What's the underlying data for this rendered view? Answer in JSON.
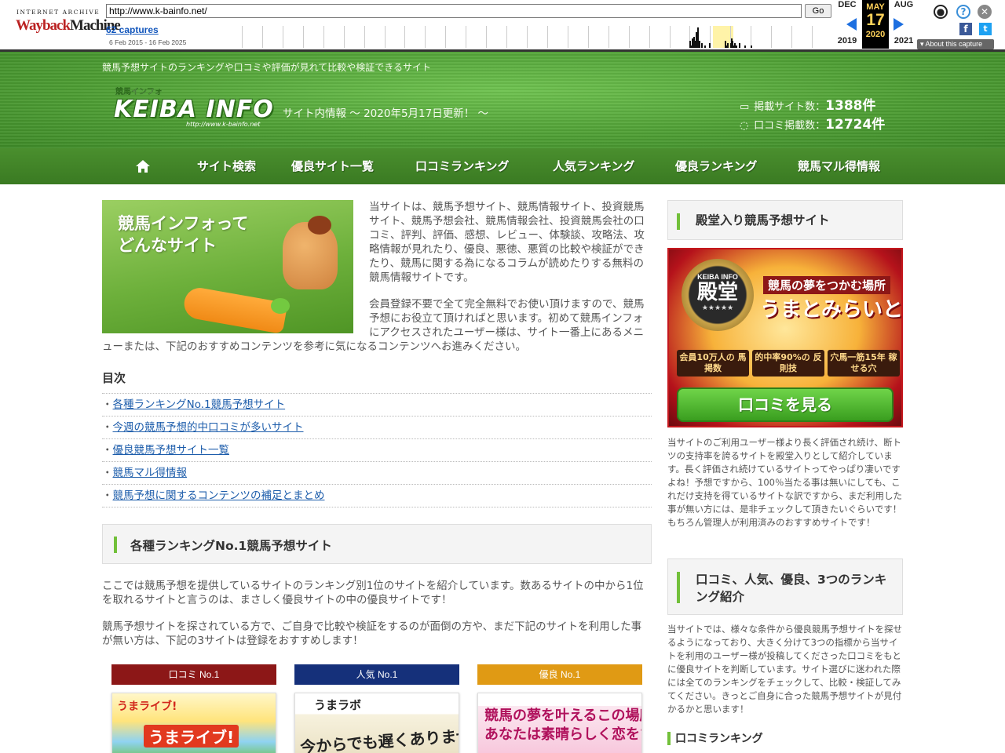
{
  "wayback": {
    "logo_top": "INTERNET ARCHIVE",
    "logo_wayback": "Wayback",
    "logo_machine": "Machine",
    "url": "http://www.k-bainfo.net/",
    "go_label": "Go",
    "captures": "62 captures",
    "range": "6 Feb 2015 - 16 Feb 2025",
    "prev_month": "DEC",
    "cur_month": "MAY",
    "next_month": "AUG",
    "cur_day": "17",
    "prev_year": "2019",
    "cur_year": "2020",
    "next_year": "2021",
    "about": "About this capture",
    "sparkline": [
      0,
      0,
      0,
      0,
      0,
      0,
      0,
      0,
      0,
      0,
      0,
      0,
      0,
      0,
      0,
      0,
      0,
      0,
      0,
      0,
      0,
      0,
      0,
      0,
      0,
      0,
      0,
      0,
      0,
      0,
      0,
      0,
      0,
      0,
      0,
      0,
      0,
      0,
      0,
      0,
      0,
      0,
      0,
      0,
      0,
      0,
      0,
      0,
      0,
      0,
      0,
      0,
      0,
      0,
      0,
      0,
      0,
      0,
      0,
      0,
      0,
      0,
      0,
      0,
      0,
      0,
      0,
      0,
      0,
      0,
      0,
      0,
      0,
      0,
      0,
      0,
      0,
      0,
      0,
      0,
      0,
      0,
      0,
      0,
      0,
      0,
      0,
      0,
      0,
      0,
      0,
      0,
      0,
      0,
      0,
      0,
      0,
      0,
      0,
      0,
      0,
      0,
      0,
      0,
      0,
      0,
      0,
      0,
      0,
      0,
      0,
      0,
      0,
      0,
      0,
      0,
      0,
      0,
      0,
      0,
      0,
      0,
      0,
      0,
      0,
      0,
      0,
      0,
      0,
      0,
      0,
      0,
      0,
      0,
      0,
      0,
      0,
      0,
      0,
      0,
      0,
      0,
      0,
      0,
      0,
      0,
      0,
      0,
      0,
      0,
      0,
      0,
      0,
      0,
      0,
      0,
      0,
      0,
      0,
      0,
      0,
      0,
      0,
      0,
      0,
      0,
      0,
      0,
      0,
      0,
      0,
      0,
      0,
      0,
      0,
      0,
      0,
      0,
      0,
      0,
      0,
      0,
      0,
      0,
      0,
      0,
      0,
      0,
      0,
      0,
      0,
      0,
      0,
      0,
      0,
      0,
      0,
      0,
      0,
      0,
      0,
      0,
      0,
      0,
      0,
      0,
      0,
      0,
      0,
      0,
      0,
      0,
      0,
      0,
      0,
      0,
      0,
      0,
      0,
      0,
      0,
      0,
      0,
      0,
      0,
      0,
      0,
      0,
      0,
      0,
      0,
      0,
      0,
      0,
      0,
      0,
      0,
      0,
      0,
      0,
      0,
      0,
      0,
      0,
      0,
      0,
      0,
      0,
      0,
      0,
      0,
      0,
      0,
      0,
      0,
      0,
      0,
      0,
      0,
      0,
      0,
      0,
      0,
      0,
      0,
      0,
      0,
      0,
      0,
      0,
      0,
      0,
      0,
      0,
      0,
      0,
      0,
      0,
      0,
      0,
      0,
      0,
      0,
      0,
      0,
      0,
      0,
      0,
      0,
      0,
      0,
      0,
      0,
      0,
      0,
      0,
      0,
      0,
      0,
      0,
      0,
      0,
      0,
      0,
      0,
      0,
      0,
      0,
      0,
      0,
      0,
      0,
      0,
      0,
      0,
      0,
      0,
      0,
      0,
      0,
      0,
      0,
      0,
      0,
      0,
      0,
      0,
      0,
      0,
      0,
      0,
      0,
      0,
      0,
      0,
      0,
      0,
      0,
      0,
      0,
      0,
      0,
      0,
      0,
      0,
      0,
      0,
      0,
      0,
      0,
      0,
      0,
      0,
      0,
      0,
      0,
      0,
      0,
      0,
      0,
      0,
      0,
      0,
      0,
      0,
      0,
      0,
      0,
      0,
      0,
      0,
      0,
      0,
      0,
      0,
      0,
      0,
      0,
      0,
      0,
      0,
      0,
      0,
      0,
      0,
      0,
      0,
      0,
      0,
      0,
      0,
      0,
      0,
      0,
      0,
      0,
      0,
      0,
      0,
      0,
      0,
      0,
      0,
      0,
      0,
      0,
      0,
      0,
      0,
      0,
      0,
      0,
      0,
      0,
      0,
      0,
      0,
      0,
      0,
      0,
      0,
      0,
      0,
      0,
      0,
      0,
      0,
      0,
      0,
      0,
      0,
      0,
      0,
      0,
      0,
      0,
      0,
      0,
      0,
      0,
      0,
      0,
      0,
      0,
      0,
      0,
      0,
      0,
      0,
      0,
      0,
      0,
      0,
      0,
      0,
      0,
      0,
      0,
      0,
      0,
      0,
      0,
      0,
      0,
      0,
      0,
      0,
      0,
      0,
      0,
      0,
      0,
      0,
      0,
      0,
      0,
      0,
      0,
      0,
      0,
      0,
      0,
      0,
      0,
      0,
      0,
      0,
      0,
      0,
      0,
      0,
      0,
      0,
      0,
      0,
      0,
      0,
      0,
      0,
      0,
      0,
      0,
      0,
      0,
      0,
      0,
      0,
      0,
      0,
      0,
      0,
      0,
      0,
      0,
      0,
      0,
      0,
      0,
      0,
      0,
      0,
      0,
      0,
      0,
      0,
      0,
      0,
      0,
      0,
      0,
      0,
      0,
      0,
      0,
      0,
      0,
      0,
      0,
      0,
      0,
      0,
      0,
      0,
      0,
      0,
      0,
      0,
      0,
      0,
      0,
      0,
      0,
      0,
      0,
      0,
      0,
      0,
      0,
      0,
      0,
      0,
      0,
      0,
      0,
      0,
      0,
      0,
      0,
      0,
      0,
      3,
      1,
      0,
      4,
      2,
      5,
      3,
      0,
      7,
      1,
      9,
      0,
      3,
      0,
      0,
      2,
      0,
      0,
      0,
      1,
      0,
      0,
      0,
      0,
      0,
      2,
      0,
      0,
      0,
      0,
      0,
      0,
      0,
      0,
      0,
      0,
      0,
      0,
      0,
      0,
      0,
      0,
      0,
      0,
      0,
      3,
      1,
      0,
      2,
      0,
      0,
      0,
      2,
      4,
      3,
      1,
      0,
      2,
      0,
      1,
      0,
      0,
      0,
      2,
      0,
      0,
      0,
      0,
      0,
      0,
      1,
      0,
      0,
      0,
      0,
      0,
      0,
      0,
      1,
      0,
      0,
      0,
      0,
      0,
      0,
      0,
      0,
      0,
      0,
      0,
      0,
      0,
      0,
      0,
      0,
      0,
      0,
      0,
      0,
      0,
      0,
      0,
      0,
      0,
      0,
      0,
      0,
      0,
      0,
      0,
      0,
      0,
      0,
      0,
      0,
      0,
      0,
      0,
      0,
      0,
      0,
      0,
      0,
      0,
      0,
      0,
      0,
      0,
      0,
      0,
      0,
      0,
      0,
      0,
      0,
      0,
      0,
      0,
      0,
      0,
      0,
      0,
      0,
      0,
      0,
      0,
      0,
      0,
      0,
      0,
      0,
      0,
      0,
      0,
      0,
      0,
      0,
      0,
      0,
      0,
      0,
      0,
      0,
      0,
      0,
      0,
      0,
      0,
      0,
      0,
      0,
      0,
      0,
      0,
      0,
      0,
      0,
      0,
      0,
      0,
      0,
      0
    ]
  },
  "header": {
    "tagline": "競馬予想サイトのランキングや口コミや評価が見れて比較や検証できるサイト",
    "logo_kana": "競馬インフォ",
    "logo_main": "KEIBA INFO",
    "logo_url": "http://www.k-bainfo.net",
    "site_info": "サイト内情報 〜 2020年5月17日更新！ 〜",
    "stat1_label": "掲載サイト数：",
    "stat1_value": "1388件",
    "stat2_label": "口コミ掲載数：",
    "stat2_value": "12724件"
  },
  "nav": {
    "items": [
      "サイト検索",
      "優良サイト一覧",
      "口コミランキング",
      "人気ランキング",
      "優良ランキング",
      "競馬マル得情報"
    ]
  },
  "main": {
    "hero_title_1": "競馬インフォって",
    "hero_title_2": "どんなサイト",
    "intro_1": "当サイトは、競馬予想サイト、競馬情報サイト、投資競馬サイト、競馬予想会社、競馬情報会社、投資競馬会社の口コミ、評判、評価、感想、レビュー、体験談、攻略法、攻略情報が見れたり、優良、悪徳、悪質の比較や検証ができたり、競馬に関する為になるコラムが読めたりする無料の競馬情報サイトです。",
    "intro_2": "会員登録不要で全て完全無料でお使い頂けますので、競馬予想にお役立て頂ければと思います。初めて競馬インフォにアクセスされたユーザー様は、サイト一番上にあるメニューまたは、下記のおすすめコンテンツを参考に気になるコンテンツへお進みください。",
    "toc_title": "目次",
    "toc": [
      "各種ランキングNo.1競馬予想サイト",
      "今週の競馬予想的中口コミが多いサイト",
      "優良競馬予想サイト一覧",
      "競馬マル得情報",
      "競馬予想に関するコンテンツの補足とまとめ"
    ],
    "section1_title": "各種ランキングNo.1競馬予想サイト",
    "p1": "ここでは競馬予想を提供しているサイトのランキング別1位のサイトを紹介しています。数あるサイトの中から1位を取れるサイトと言うのは、まさしく優良サイトの中の優良サイトです！",
    "p2": "競馬予想サイトを探されている方で、ご自身で比較や検証をするのが面倒の方や、まだ下記のサイトを利用した事が無い方は、下記の3サイトは登録をおすすめします！",
    "rank_heads": [
      "口コミ No.1",
      "人気 No.1",
      "優良 No.1"
    ],
    "rank_cards": [
      {
        "cap": "うまライブ!",
        "cap2": "うまライブ!"
      },
      {
        "cap": "うまラボ",
        "cap2": "今からでも遅くありません!"
      },
      {
        "cap": "競馬の夢を叶えるこの場所に",
        "cap2": "あなたは素晴らしく恋をする"
      }
    ]
  },
  "side": {
    "h1": "殿堂入り競馬予想サイト",
    "banner_emblem_top": "KEIBA INFO",
    "banner_emblem": "殿堂",
    "banner_stars": "★★★★★",
    "banner_tagline": "競馬の夢をつかむ場所",
    "banner_name": "うまとみらいと",
    "banner_feats": [
      "会員10万人の 馬掲数",
      "的中率90%の 反則技",
      "穴馬一筋15年 稼せる穴"
    ],
    "banner_btn": "口コミを見る",
    "p1": "当サイトのご利用ユーザー様より長く評価され続け、断トツの支持率を誇るサイトを殿堂入りとして紹介しています。長く評価され続けているサイトってやっぱり凄いですよね！予想ですから、100％当たる事は無いにしても、これだけ支持を得ているサイトな訳ですから、まだ利用した事が無い方には、是非チェックして頂きたいぐらいです！もちろん管理人が利用済みのおすすめサイトです！",
    "h2": "口コミ、人気、優良、3つのランキング紹介",
    "p2": "当サイトでは、様々な条件から優良競馬予想サイトを探せるようになっており、大きく分けて3つの指標から当サイトを利用のユーザー様が投稿してくださった口コミをもとに優良サイトを判断しています。サイト選びに迷われた際には全てのランキングをチェックして、比較・検証してみてください。きっとご自身に合った競馬予想サイトが見付かるかと思います！",
    "h3": "口コミランキング"
  }
}
